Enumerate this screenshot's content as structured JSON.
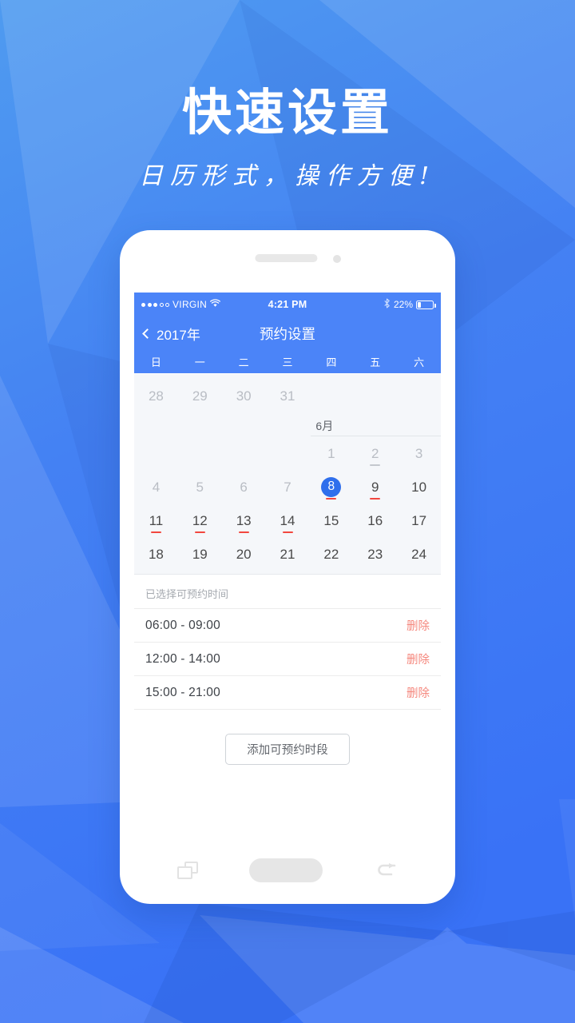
{
  "poster": {
    "headline": "快速设置",
    "subheadline": "日历形式，操作方便!",
    "bg_color_top": "#4d96ef",
    "bg_color_bottom": "#3a74f5"
  },
  "phone": {
    "speaker_icon": "speaker-grille",
    "camera_icon": "front-camera"
  },
  "statusbar": {
    "signal_dots_filled": 3,
    "signal_dots_total": 5,
    "carrier": "VIRGIN",
    "wifi_icon": "wifi-icon",
    "time": "4:21 PM",
    "bluetooth_icon": "bluetooth-icon",
    "battery_percent": "22%",
    "battery_level": 22
  },
  "navbar": {
    "back_icon": "chevron-left-icon",
    "back_label": "2017年",
    "title": "预约设置",
    "bg_color": "#4b84f8"
  },
  "calendar": {
    "weekdays": [
      "日",
      "一",
      "二",
      "三",
      "四",
      "五",
      "六"
    ],
    "month_label": "6月",
    "selected_color": "#2f6fec",
    "mark_color": "#f2473f",
    "rows": [
      [
        {
          "d": "28",
          "state": "muted",
          "mark": "none"
        },
        {
          "d": "29",
          "state": "muted",
          "mark": "none"
        },
        {
          "d": "30",
          "state": "muted",
          "mark": "none"
        },
        {
          "d": "31",
          "state": "muted",
          "mark": "none"
        },
        {
          "d": "",
          "state": "empty",
          "mark": "none"
        },
        {
          "d": "",
          "state": "empty",
          "mark": "none"
        },
        {
          "d": "",
          "state": "empty",
          "mark": "none"
        }
      ],
      [
        {
          "d": "",
          "state": "empty",
          "mark": "none"
        },
        {
          "d": "",
          "state": "empty",
          "mark": "none"
        },
        {
          "d": "",
          "state": "empty",
          "mark": "none"
        },
        {
          "d": "",
          "state": "empty",
          "mark": "none"
        },
        {
          "d": "1",
          "state": "muted",
          "mark": "none"
        },
        {
          "d": "2",
          "state": "muted",
          "mark": "grey"
        },
        {
          "d": "3",
          "state": "muted",
          "mark": "none"
        }
      ],
      [
        {
          "d": "4",
          "state": "muted",
          "mark": "none"
        },
        {
          "d": "5",
          "state": "muted",
          "mark": "none"
        },
        {
          "d": "6",
          "state": "muted",
          "mark": "none"
        },
        {
          "d": "7",
          "state": "muted",
          "mark": "none"
        },
        {
          "d": "8",
          "state": "selected",
          "mark": "red"
        },
        {
          "d": "9",
          "state": "normal",
          "mark": "red"
        },
        {
          "d": "10",
          "state": "normal",
          "mark": "none"
        }
      ],
      [
        {
          "d": "11",
          "state": "normal",
          "mark": "red"
        },
        {
          "d": "12",
          "state": "normal",
          "mark": "red"
        },
        {
          "d": "13",
          "state": "normal",
          "mark": "red"
        },
        {
          "d": "14",
          "state": "normal",
          "mark": "red"
        },
        {
          "d": "15",
          "state": "normal",
          "mark": "none"
        },
        {
          "d": "16",
          "state": "normal",
          "mark": "none"
        },
        {
          "d": "17",
          "state": "normal",
          "mark": "none"
        }
      ],
      [
        {
          "d": "18",
          "state": "normal",
          "mark": "none"
        },
        {
          "d": "19",
          "state": "normal",
          "mark": "none"
        },
        {
          "d": "20",
          "state": "normal",
          "mark": "none"
        },
        {
          "d": "21",
          "state": "normal",
          "mark": "none"
        },
        {
          "d": "22",
          "state": "normal",
          "mark": "none"
        },
        {
          "d": "23",
          "state": "normal",
          "mark": "none"
        },
        {
          "d": "24",
          "state": "normal",
          "mark": "none"
        }
      ]
    ]
  },
  "slots": {
    "section_title": "已选择可预约时间",
    "delete_label": "删除",
    "delete_color": "#f5897f",
    "items": [
      {
        "time": "06:00 - 09:00",
        "delete": "删除"
      },
      {
        "time": "12:00 - 14:00",
        "delete": "删除"
      },
      {
        "time": "15:00 - 21:00",
        "delete": "删除"
      }
    ],
    "add_button": "添加可预约时段"
  },
  "androidnav": {
    "recent_icon": "recent-apps-icon",
    "home_icon": "home-pill-icon",
    "back_icon": "back-arrow-icon"
  }
}
